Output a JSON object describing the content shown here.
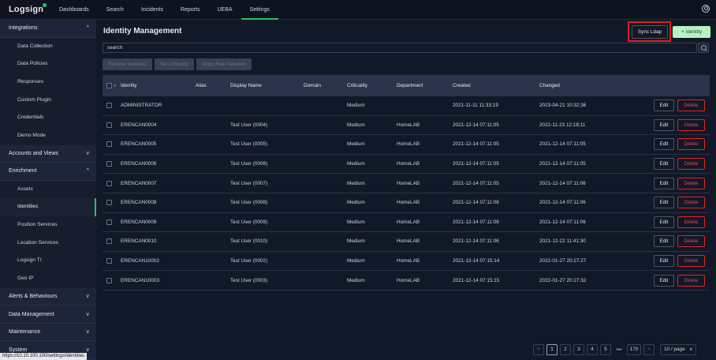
{
  "app": {
    "logo": "Logsign",
    "nav": [
      "Dashboards",
      "Search",
      "Incidents",
      "Reports",
      "UEBA",
      "Settings"
    ],
    "active_nav": "Settings"
  },
  "sidebar": {
    "sections": [
      {
        "label": "Integrations",
        "chev": "^",
        "items": [
          "Data Collection",
          "Data Policies",
          "Responses",
          "Custom Plugin",
          "Credentials",
          "Demo Mode"
        ]
      },
      {
        "label": "Accounts and Views",
        "chev": "v",
        "items": []
      },
      {
        "label": "Enrichment",
        "chev": "^",
        "items": [
          "Assets",
          "Identities",
          "Position Services",
          "Location Services",
          "Logsign TI",
          "Geo IP"
        ]
      },
      {
        "label": "Alerts & Behaviours",
        "chev": "v",
        "items": []
      },
      {
        "label": "Data Management",
        "chev": "v",
        "items": []
      },
      {
        "label": "Maintenance",
        "chev": "v",
        "items": []
      },
      {
        "label": "System",
        "chev": "v",
        "items": []
      }
    ],
    "active_item": "Identities",
    "status_url": "https://10.10.100.100/settings/identities"
  },
  "page": {
    "title": "Identity Management",
    "sync_label": "Sync Ldap",
    "add_label": "+  Identity",
    "search_value": "search",
    "actions": [
      "Remove Selected",
      "Set Criticality",
      "Apply Role Selected"
    ]
  },
  "table": {
    "headers": {
      "identity": "Identity",
      "alias": "Alias",
      "display_name": "Display Name",
      "domain": "Domain",
      "criticality": "Criticality",
      "department": "Department",
      "created": "Created",
      "changed": "Changed"
    },
    "edit_label": "Edit",
    "delete_label": "Delete",
    "rows": [
      {
        "identity": "ADMINISTRATOR",
        "alias": "",
        "display_name": "",
        "domain": "",
        "criticality": "Medium",
        "department": "",
        "created": "2021-11-11 11:33:19",
        "changed": "2023-04-21 10:32:36"
      },
      {
        "identity": "ERENCAN0004",
        "alias": "",
        "display_name": "Test User (0004)",
        "domain": "",
        "criticality": "Medium",
        "department": "HomeLAB",
        "created": "2021-12-14 07:11:05",
        "changed": "2022-11-23 12:18:11"
      },
      {
        "identity": "ERENCAN0005",
        "alias": "",
        "display_name": "Test User (0005)",
        "domain": "",
        "criticality": "Medium",
        "department": "HomeLAB",
        "created": "2021-12-14 07:11:05",
        "changed": "2021-12-14 07:11:05"
      },
      {
        "identity": "ERENCAN0006",
        "alias": "",
        "display_name": "Test User (0006)",
        "domain": "",
        "criticality": "Medium",
        "department": "HomeLAB",
        "created": "2021-12-14 07:11:05",
        "changed": "2021-12-14 07:11:05"
      },
      {
        "identity": "ERENCAN0007",
        "alias": "",
        "display_name": "Test User (0007)",
        "domain": "",
        "criticality": "Medium",
        "department": "HomeLAB",
        "created": "2021-12-14 07:11:05",
        "changed": "2021-12-14 07:11:06"
      },
      {
        "identity": "ERENCAN0008",
        "alias": "",
        "display_name": "Test User (0008)",
        "domain": "",
        "criticality": "Medium",
        "department": "HomeLAB",
        "created": "2021-12-14 07:11:06",
        "changed": "2021-12-14 07:11:06"
      },
      {
        "identity": "ERENCAN0009",
        "alias": "",
        "display_name": "Test User (0009)",
        "domain": "",
        "criticality": "Medium",
        "department": "HomeLAB",
        "created": "2021-12-14 07:11:06",
        "changed": "2021-12-14 07:11:06"
      },
      {
        "identity": "ERENCAN0010",
        "alias": "",
        "display_name": "Test User (0010)",
        "domain": "",
        "criticality": "Medium",
        "department": "HomeLAB",
        "created": "2021-12-14 07:11:06",
        "changed": "2021-12-22 11:41:30"
      },
      {
        "identity": "ERENCAN10002",
        "alias": "",
        "display_name": "Test User (0002)",
        "domain": "",
        "criticality": "Medium",
        "department": "HomeLAB",
        "created": "2021-12-14 07:15:14",
        "changed": "2022-01-27 20:27:27"
      },
      {
        "identity": "ERENCAN10003",
        "alias": "",
        "display_name": "Test User (0003)",
        "domain": "",
        "criticality": "Medium",
        "department": "HomeLAB",
        "created": "2021-12-14 07:15:15",
        "changed": "2022-01-27 20:27:32"
      }
    ]
  },
  "pagination": {
    "prev": "<",
    "pages": [
      "1",
      "2",
      "3",
      "4",
      "5"
    ],
    "active_page": "1",
    "dots": "•••",
    "last": "170",
    "next": ">",
    "per_page": "10 / page"
  },
  "colors": {
    "accent": "#22c55e",
    "danger": "#dc2626",
    "highlight": "#e11d1d"
  }
}
